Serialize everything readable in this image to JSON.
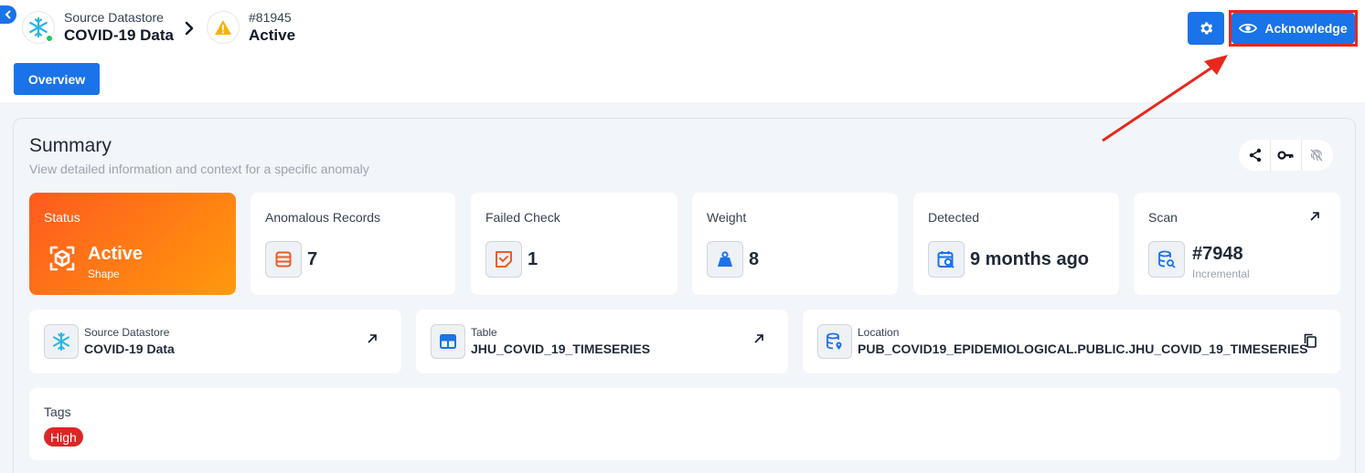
{
  "header": {
    "datastore": {
      "label": "Source Datastore",
      "name": "COVID-19 Data"
    },
    "anomaly": {
      "id": "#81945",
      "status": "Active"
    },
    "acknowledge_label": "Acknowledge"
  },
  "tabs": [
    {
      "label": "Overview",
      "active": true
    }
  ],
  "summary": {
    "title": "Summary",
    "subtitle": "View detailed information and context for a specific anomaly",
    "cards": {
      "status": {
        "label": "Status",
        "value": "Active",
        "sub": "Shape"
      },
      "anomalous_records": {
        "label": "Anomalous Records",
        "value": "7"
      },
      "failed_check": {
        "label": "Failed Check",
        "value": "1"
      },
      "weight": {
        "label": "Weight",
        "value": "8"
      },
      "detected": {
        "label": "Detected",
        "value": "9 months ago"
      },
      "scan": {
        "label": "Scan",
        "value": "#7948",
        "sub": "Incremental"
      }
    },
    "info": {
      "datastore": {
        "label": "Source Datastore",
        "value": "COVID-19 Data"
      },
      "table": {
        "label": "Table",
        "value": "JHU_COVID_19_TIMESERIES"
      },
      "location": {
        "label": "Location",
        "value": "PUB_COVID19_EPIDEMIOLOGICAL.PUBLIC.JHU_COVID_19_TIMESERIES"
      }
    },
    "tags": {
      "label": "Tags",
      "items": [
        "High"
      ]
    }
  },
  "colors": {
    "primary": "#1a73e8",
    "status_gradient_start": "#ff5a1f",
    "status_gradient_end": "#ff9a0c",
    "tag_high": "#dc2626",
    "annotation_red": "#e8271e",
    "online": "#22c55e"
  },
  "icons": {
    "collapse": "chevron-left-icon",
    "datastore": "snowflake-icon",
    "anomaly": "warning-triangle-icon",
    "settings": "gear-icon",
    "acknowledge": "eye-icon",
    "share": "share-icon",
    "key": "key-icon",
    "fingerprint": "fingerprint-off-icon"
  }
}
